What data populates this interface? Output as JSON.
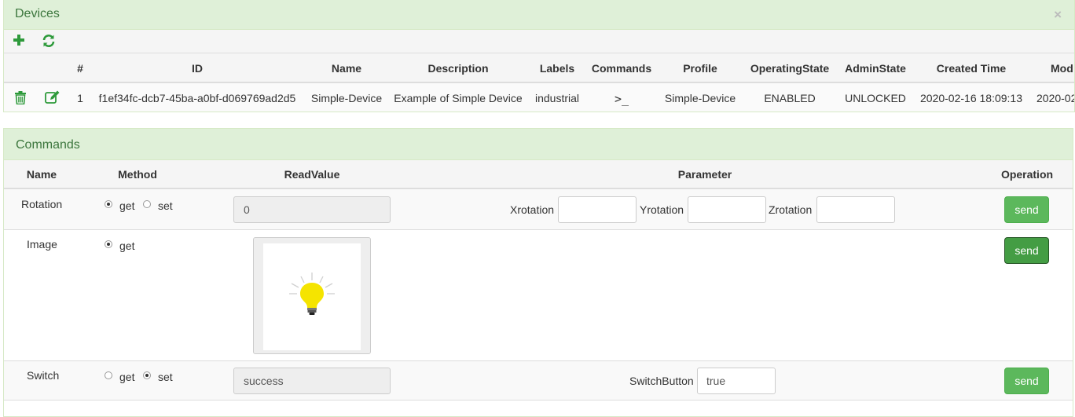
{
  "devices": {
    "title": "Devices",
    "close_icon": "×",
    "toolbar": {
      "add_icon": "plus-icon",
      "refresh_icon": "refresh-icon"
    },
    "columns": [
      "#",
      "ID",
      "Name",
      "Description",
      "Labels",
      "Commands",
      "Profile",
      "OperatingState",
      "AdminState",
      "Created Time",
      "Mod"
    ],
    "rows": [
      {
        "num": "1",
        "id": "f1ef34fc-dcb7-45ba-a0bf-d069769ad2d5",
        "name": "Simple-Device",
        "description": "Example of Simple Device",
        "labels": "industrial",
        "commands": ">_",
        "profile": "Simple-Device",
        "operating_state": "ENABLED",
        "admin_state": "UNLOCKED",
        "created": "2020-02-16 18:09:13",
        "modified": "2020-02"
      }
    ]
  },
  "commands": {
    "title": "Commands",
    "columns": {
      "name": "Name",
      "method": "Method",
      "read_value": "ReadValue",
      "parameter": "Parameter",
      "operation": "Operation"
    },
    "method_labels": {
      "get": "get",
      "set": "set"
    },
    "rows": {
      "rotation": {
        "name": "Rotation",
        "read_value": "0",
        "params": [
          {
            "label": "Xrotation",
            "value": ""
          },
          {
            "label": "Yrotation",
            "value": ""
          },
          {
            "label": "Zrotation",
            "value": ""
          }
        ],
        "button": "send"
      },
      "image": {
        "name": "Image",
        "button": "send"
      },
      "switch": {
        "name": "Switch",
        "read_value": "success",
        "params": [
          {
            "label": "SwitchButton",
            "value": "true"
          }
        ],
        "button": "send"
      }
    }
  },
  "colors": {
    "header_bg": "#dff0d8",
    "header_text": "#3c763d",
    "accent": "#5cb85c",
    "accent_dark": "#449d44"
  }
}
